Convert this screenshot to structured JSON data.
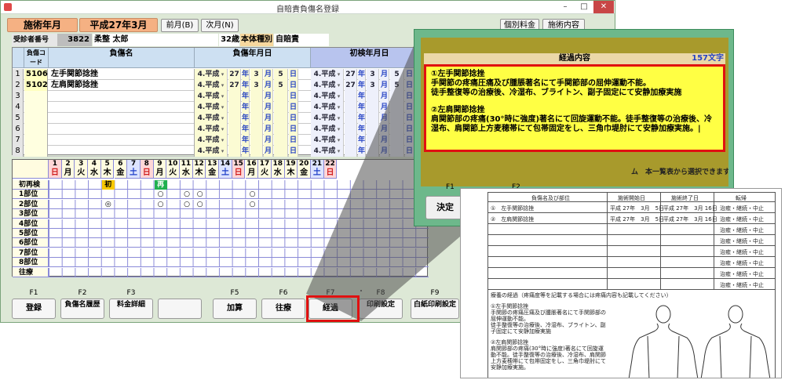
{
  "window": {
    "title": "自賠責負傷名登録",
    "controls": [
      "–",
      "□",
      "✕"
    ]
  },
  "header": {
    "label_year": "施術年月",
    "year_value": "平成27年3月",
    "prev_btn": "前月(B)",
    "next_btn": "次月(N)",
    "fee_btn": "個別料金",
    "detail_btn": "施術内容"
  },
  "patient": {
    "id_label": "受診者番号",
    "id": "3822",
    "name": "柔整 太郎",
    "age": "32歳",
    "type_label": "本体種別",
    "type": "自賠責"
  },
  "table_headers": {
    "code": "負傷コード",
    "name": "負傷名",
    "injury_date": "負傷年月日",
    "first_date": "初検年月日"
  },
  "rows": [
    {
      "n": "1",
      "code": "5106",
      "name": "左手関節捻挫",
      "era": "4.平成",
      "y": "27",
      "m": "3",
      "d": "5",
      "era2": "4.平成",
      "y2": "27",
      "m2": "3",
      "d2": "5"
    },
    {
      "n": "2",
      "code": "5102",
      "name": "左肩関節捻挫",
      "era": "4.平成",
      "y": "27",
      "m": "3",
      "d": "5",
      "era2": "4.平成",
      "y2": "27",
      "m2": "3",
      "d2": "5"
    },
    {
      "n": "3",
      "code": "",
      "name": "",
      "era": "4.平成",
      "y": "",
      "m": "",
      "d": "",
      "era2": "4.平成",
      "y2": "",
      "m2": "",
      "d2": ""
    },
    {
      "n": "4",
      "code": "",
      "name": "",
      "era": "4.平成",
      "y": "",
      "m": "",
      "d": "",
      "era2": "4.平成",
      "y2": "",
      "m2": "",
      "d2": ""
    },
    {
      "n": "5",
      "code": "",
      "name": "",
      "era": "4.平成",
      "y": "",
      "m": "",
      "d": "",
      "era2": "4.平成",
      "y2": "",
      "m2": "",
      "d2": ""
    },
    {
      "n": "6",
      "code": "",
      "name": "",
      "era": "4.平成",
      "y": "",
      "m": "",
      "d": "",
      "era2": "4.平成",
      "y2": "",
      "m2": "",
      "d2": ""
    },
    {
      "n": "7",
      "code": "",
      "name": "",
      "era": "4.平成",
      "y": "",
      "m": "",
      "d": "",
      "era2": "4.平成",
      "y2": "",
      "m2": "",
      "d2": ""
    },
    {
      "n": "8",
      "code": "",
      "name": "",
      "era": "4.平成",
      "y": "",
      "m": "",
      "d": "",
      "era2": "4.平成",
      "y2": "",
      "m2": "",
      "d2": ""
    }
  ],
  "date_units": {
    "y": "年",
    "m": "月",
    "d": "日"
  },
  "calendar": {
    "days": [
      {
        "d": "1",
        "w": "日",
        "c": "red"
      },
      {
        "d": "2",
        "w": "月",
        "c": "n"
      },
      {
        "d": "3",
        "w": "火",
        "c": "n"
      },
      {
        "d": "4",
        "w": "水",
        "c": "n"
      },
      {
        "d": "5",
        "w": "木",
        "c": "n"
      },
      {
        "d": "6",
        "w": "金",
        "c": "n"
      },
      {
        "d": "7",
        "w": "土",
        "c": "blue"
      },
      {
        "d": "8",
        "w": "日",
        "c": "red"
      },
      {
        "d": "9",
        "w": "月",
        "c": "n"
      },
      {
        "d": "10",
        "w": "火",
        "c": "n"
      },
      {
        "d": "11",
        "w": "水",
        "c": "n"
      },
      {
        "d": "12",
        "w": "木",
        "c": "n"
      },
      {
        "d": "13",
        "w": "金",
        "c": "n"
      },
      {
        "d": "14",
        "w": "土",
        "c": "blue"
      },
      {
        "d": "15",
        "w": "日",
        "c": "red"
      },
      {
        "d": "16",
        "w": "月",
        "c": "n"
      },
      {
        "d": "17",
        "w": "火",
        "c": "n"
      },
      {
        "d": "18",
        "w": "水",
        "c": "n"
      },
      {
        "d": "19",
        "w": "木",
        "c": "n"
      },
      {
        "d": "20",
        "w": "金",
        "c": "n"
      },
      {
        "d": "21",
        "w": "土",
        "c": "blue"
      },
      {
        "d": "22",
        "w": "日",
        "c": "red"
      }
    ],
    "rows": [
      "初再検",
      "1部位",
      "2部位",
      "3部位",
      "4部位",
      "5部位",
      "6部位",
      "7部位",
      "8部位",
      "往療"
    ],
    "marks": {
      "first": "初",
      "re": "再",
      "circle": "○",
      "double": "◎"
    }
  },
  "fkeys": [
    {
      "k": "F1",
      "label": "登録"
    },
    {
      "k": "F2",
      "label": "負傷名履歴"
    },
    {
      "k": "F3",
      "label": "料金詳細"
    },
    {
      "k": "",
      "label": ""
    },
    {
      "k": "F5",
      "label": "加算"
    },
    {
      "k": "F6",
      "label": "往療"
    },
    {
      "k": "F7",
      "label": "経過"
    },
    {
      "k": "F8",
      "label": "印刷設定"
    },
    {
      "k": "F9",
      "label": "白紙印刷設定"
    }
  ],
  "panel": {
    "title": "経過内容",
    "count": "157文字",
    "p1": "①左手関節捻挫",
    "p2": "手関節の疼痛圧痛及び腫脹著名にて手関節部の屈伸運動不能。",
    "p3": "徒手整復等の治療後、冷湿布、ブライトン、副子固定にて安静加療実施",
    "p4": "②左肩関節捻挫",
    "p5": "肩関節部の疼痛(30°時に強度)著名にて回旋運動不能。徒手整復等の治療後、冷湿布、肩関節上方麦穂帯にて包帯固定をし、三角巾堤肘にて安静加療実施。|",
    "f1": "F1",
    "f2": "F2",
    "kettei": "決定",
    "partial": "ム　本一覧表から選択できます"
  },
  "doc": {
    "h1": "負傷名及び部位",
    "h2": "施術開始日",
    "h3": "施術終了日",
    "h4": "転帰",
    "r1n": "①　左手関節捻挫",
    "r1s": "平成 27年　3月　5日",
    "r1e": "平成 27年　3月 16日",
    "r2n": "②　左肩関節捻挫",
    "r2s": "平成 27年　3月　5日",
    "r2e": "平成 27年　3月 16日",
    "tenki": "治癒・継続・中止",
    "note": "療養の経過（疼痛度等を記載する場合には疼痛内容も記載してください）",
    "t1": "①左手関節捻挫",
    "t2": "手関節の疼痛圧痛及び腫脹著名にて手関節部の",
    "t3": "屈伸運動不能。",
    "t4": "徒手整復等の治療後、冷湿布、ブライトン、副",
    "t5": "子固定にて安静加療実施",
    "t6": "②左肩関節捻挫",
    "t7": "肩関節部の疼痛(30°時に強度)著名にて回旋運",
    "t8": "動不能。徒手整復等の治療後、冷湿布、肩関節",
    "t9": "上方麦穂帯にて包帯固定をし、三角巾堤肘にて",
    "t10": "安静加療実施。"
  }
}
